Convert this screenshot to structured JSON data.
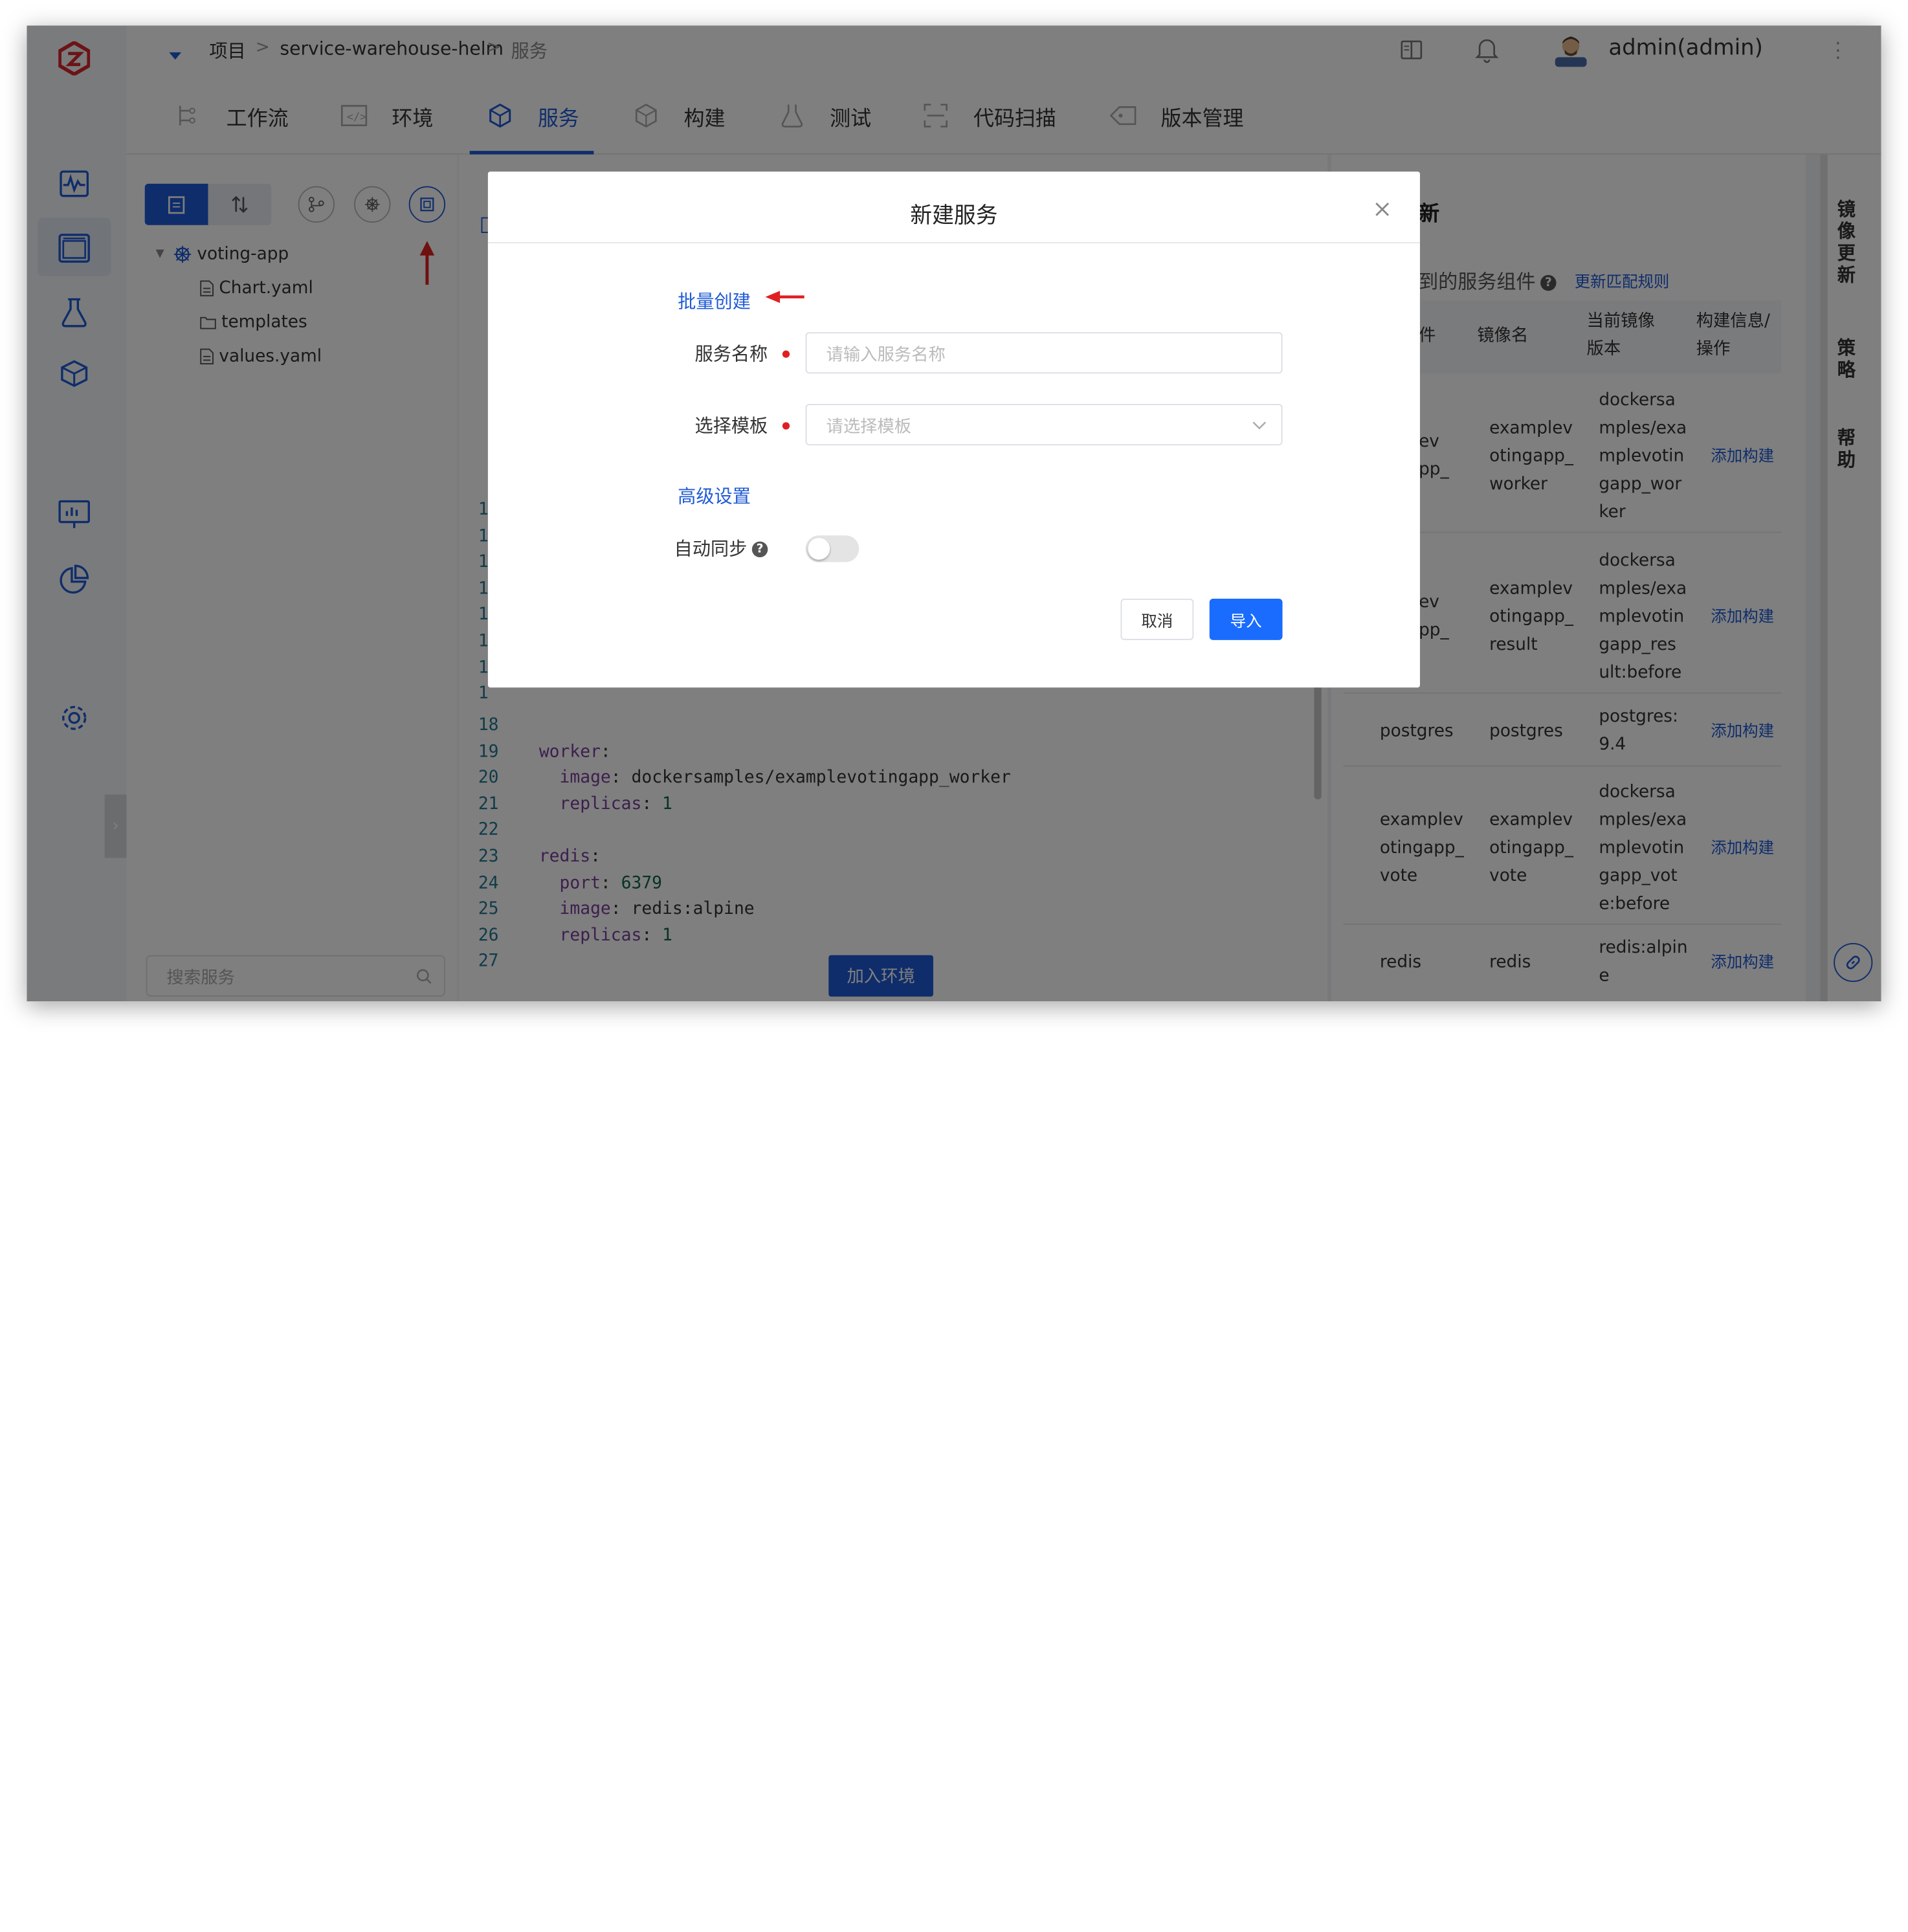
{
  "breadcrumb": {
    "root": "项目",
    "project": "service-warehouse-helm",
    "current": "服务"
  },
  "user": {
    "name": "admin(admin)"
  },
  "tabs": [
    {
      "label": "工作流"
    },
    {
      "label": "环境"
    },
    {
      "label": "服务"
    },
    {
      "label": "构建"
    },
    {
      "label": "测试"
    },
    {
      "label": "代码扫描"
    },
    {
      "label": "版本管理"
    }
  ],
  "tree": {
    "root": "voting-app",
    "files": [
      "Chart.yaml",
      "templates",
      "values.yaml"
    ],
    "search_placeholder": "搜索服务"
  },
  "editor": {
    "line_numbers_hidden": [
      "1",
      "1",
      "1",
      "1",
      "1",
      "1",
      "1",
      "1"
    ],
    "lines": [
      {
        "no": "18",
        "text": ""
      },
      {
        "no": "19",
        "text": "worker:"
      },
      {
        "no": "20",
        "text": "  image: dockersamples/examplevotingapp_worker"
      },
      {
        "no": "21",
        "text": "  replicas: 1"
      },
      {
        "no": "22",
        "text": ""
      },
      {
        "no": "23",
        "text": "redis:"
      },
      {
        "no": "24",
        "text": "  port: 6379"
      },
      {
        "no": "25",
        "text": "  image: redis:alpine"
      },
      {
        "no": "26",
        "text": "  replicas: 1"
      },
      {
        "no": "27",
        "text": ""
      }
    ],
    "join_env_label": "加入环境"
  },
  "right_panel": {
    "title_partial": "新",
    "subtitle_partial": "到的服务组件",
    "update_rule_link": "更新匹配规则",
    "col_component": "件",
    "col_image": "镜像名",
    "col_version": "当前镜像\n版本",
    "col_ops": "构建信息/\n操作",
    "rows": [
      {
        "component": "ev\npp_",
        "image": "examplev\notingapp_\nworker",
        "version": "dockersa\nmples/exa\nmplevotin\ngapp_wor\nker",
        "action": "添加构建"
      },
      {
        "component": "ev\npp_",
        "image": "examplev\notingapp_\nresult",
        "version": "dockersa\nmples/exa\nmplevotin\ngapp_res\nult:before",
        "action": "添加构建"
      },
      {
        "component": "postgres",
        "image": "postgres",
        "version": "postgres:\n9.4",
        "action": "添加构建"
      },
      {
        "component": "examplev\notingapp_\nvote",
        "image": "examplev\notingapp_\nvote",
        "version": "dockersa\nmples/exa\nmplevotin\ngapp_vot\ne:before",
        "action": "添加构建"
      },
      {
        "component": "redis",
        "image": "redis",
        "version": "redis:alpin\ne",
        "action": "添加构建"
      }
    ]
  },
  "side_tabs": [
    "镜像更新",
    "策略",
    "帮助"
  ],
  "modal": {
    "title": "新建服务",
    "batch_create": "批量创建",
    "service_name_label": "服务名称",
    "service_name_placeholder": "请输入服务名称",
    "template_label": "选择模板",
    "template_placeholder": "请选择模板",
    "advanced": "高级设置",
    "auto_sync_label": "自动同步",
    "cancel": "取消",
    "import": "导入"
  },
  "colors": {
    "primary": "#1f5bd6",
    "button_primary": "#1a6cff",
    "annotation_red": "#e02020",
    "logo_red": "#d9262c"
  }
}
